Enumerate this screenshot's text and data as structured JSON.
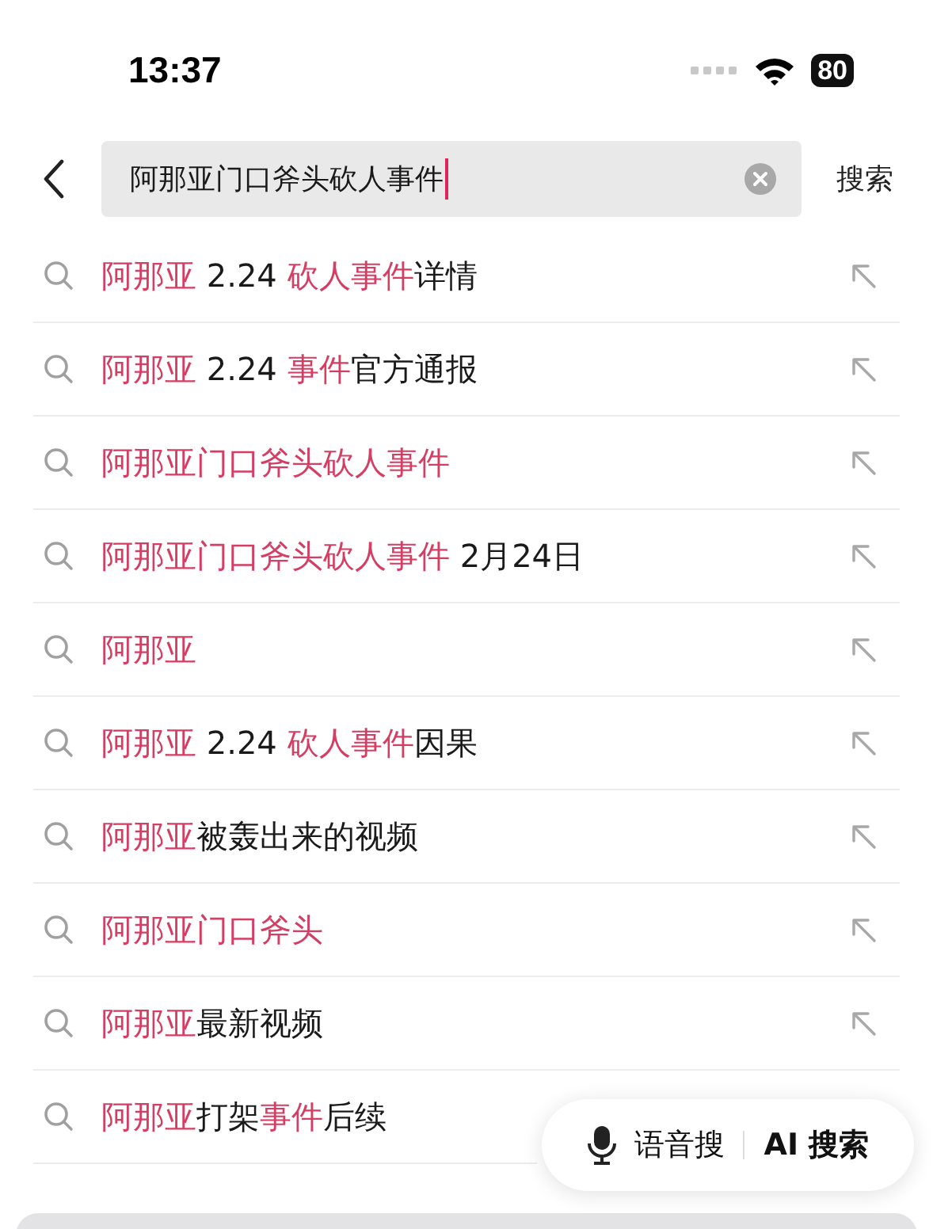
{
  "status_bar": {
    "time": "13:37",
    "battery": "80"
  },
  "search": {
    "value": "阿那亚门口斧头砍人事件",
    "button": "搜索"
  },
  "suggestions": [
    {
      "arrow": true,
      "parts": [
        {
          "text": "阿那亚",
          "match": true
        },
        {
          "text": " 2.24 ",
          "match": false
        },
        {
          "text": "砍人事件",
          "match": true
        },
        {
          "text": "详情",
          "match": false
        }
      ]
    },
    {
      "arrow": true,
      "parts": [
        {
          "text": "阿那亚",
          "match": true
        },
        {
          "text": " 2.24 ",
          "match": false
        },
        {
          "text": "事件",
          "match": true
        },
        {
          "text": "官方通报",
          "match": false
        }
      ]
    },
    {
      "arrow": true,
      "parts": [
        {
          "text": "阿那亚门口斧头砍人事件",
          "match": true
        }
      ]
    },
    {
      "arrow": true,
      "parts": [
        {
          "text": "阿那亚门口斧头砍人事件",
          "match": true
        },
        {
          "text": " 2月24日",
          "match": false
        }
      ]
    },
    {
      "arrow": true,
      "parts": [
        {
          "text": "阿那亚",
          "match": true
        }
      ]
    },
    {
      "arrow": true,
      "parts": [
        {
          "text": "阿那亚",
          "match": true
        },
        {
          "text": " 2.24 ",
          "match": false
        },
        {
          "text": "砍人事件",
          "match": true
        },
        {
          "text": "因果",
          "match": false
        }
      ]
    },
    {
      "arrow": true,
      "parts": [
        {
          "text": "阿那亚",
          "match": true
        },
        {
          "text": "被轰出来的视频",
          "match": false
        }
      ]
    },
    {
      "arrow": true,
      "parts": [
        {
          "text": "阿那亚门口斧头",
          "match": true
        }
      ]
    },
    {
      "arrow": true,
      "parts": [
        {
          "text": "阿那亚",
          "match": true
        },
        {
          "text": "最新视频",
          "match": false
        }
      ]
    },
    {
      "arrow": false,
      "parts": [
        {
          "text": "阿那亚",
          "match": true
        },
        {
          "text": "打架",
          "match": false
        },
        {
          "text": "事件",
          "match": true
        },
        {
          "text": "后续",
          "match": false
        }
      ]
    }
  ],
  "floating_bar": {
    "voice": "语音搜",
    "ai": "AI 搜索"
  }
}
